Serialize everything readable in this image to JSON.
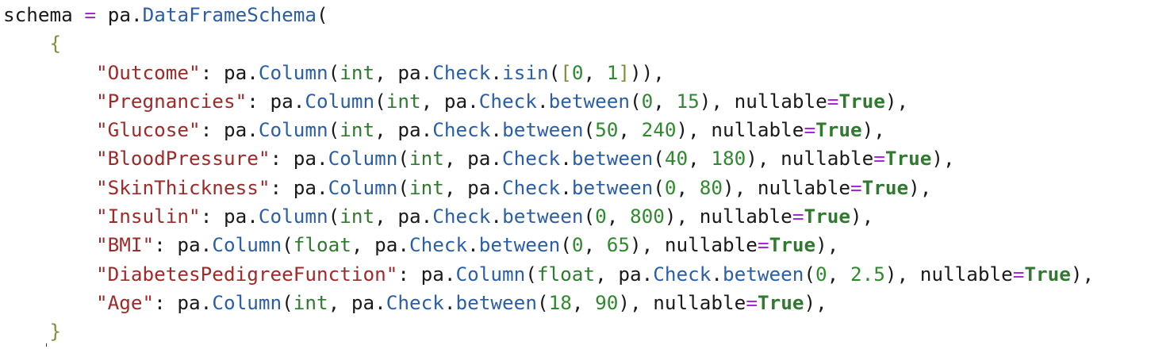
{
  "code": {
    "lines": [
      [
        {
          "t": "schema",
          "c": "plain"
        },
        {
          "t": " ",
          "c": "plain"
        },
        {
          "t": "=",
          "c": "op"
        },
        {
          "t": " pa.",
          "c": "plain"
        },
        {
          "t": "DataFrameSchema",
          "c": "attr"
        },
        {
          "t": "(",
          "c": "punct"
        }
      ],
      [
        {
          "t": "    ",
          "c": "plain"
        },
        {
          "t": "{",
          "c": "brace"
        }
      ],
      [
        {
          "t": "        ",
          "c": "plain"
        },
        {
          "t": "\"Outcome\"",
          "c": "str"
        },
        {
          "t": ": pa.",
          "c": "plain"
        },
        {
          "t": "Column",
          "c": "attr"
        },
        {
          "t": "(",
          "c": "punct"
        },
        {
          "t": "int",
          "c": "builtin"
        },
        {
          "t": ", pa.",
          "c": "plain"
        },
        {
          "t": "Check",
          "c": "attr"
        },
        {
          "t": ".",
          "c": "plain"
        },
        {
          "t": "isin",
          "c": "attr"
        },
        {
          "t": "(",
          "c": "punct"
        },
        {
          "t": "[",
          "c": "bracket"
        },
        {
          "t": "0",
          "c": "num"
        },
        {
          "t": ", ",
          "c": "plain"
        },
        {
          "t": "1",
          "c": "num"
        },
        {
          "t": "]",
          "c": "bracket"
        },
        {
          "t": ")),",
          "c": "punct"
        }
      ],
      [
        {
          "t": "        ",
          "c": "plain"
        },
        {
          "t": "\"Pregnancies\"",
          "c": "str"
        },
        {
          "t": ": pa.",
          "c": "plain"
        },
        {
          "t": "Column",
          "c": "attr"
        },
        {
          "t": "(",
          "c": "punct"
        },
        {
          "t": "int",
          "c": "builtin"
        },
        {
          "t": ", pa.",
          "c": "plain"
        },
        {
          "t": "Check",
          "c": "attr"
        },
        {
          "t": ".",
          "c": "plain"
        },
        {
          "t": "between",
          "c": "attr"
        },
        {
          "t": "(",
          "c": "punct"
        },
        {
          "t": "0",
          "c": "num"
        },
        {
          "t": ", ",
          "c": "plain"
        },
        {
          "t": "15",
          "c": "num"
        },
        {
          "t": "), nullable",
          "c": "plain"
        },
        {
          "t": "=",
          "c": "op"
        },
        {
          "t": "True",
          "c": "kw"
        },
        {
          "t": "),",
          "c": "punct"
        }
      ],
      [
        {
          "t": "        ",
          "c": "plain"
        },
        {
          "t": "\"Glucose\"",
          "c": "str"
        },
        {
          "t": ": pa.",
          "c": "plain"
        },
        {
          "t": "Column",
          "c": "attr"
        },
        {
          "t": "(",
          "c": "punct"
        },
        {
          "t": "int",
          "c": "builtin"
        },
        {
          "t": ", pa.",
          "c": "plain"
        },
        {
          "t": "Check",
          "c": "attr"
        },
        {
          "t": ".",
          "c": "plain"
        },
        {
          "t": "between",
          "c": "attr"
        },
        {
          "t": "(",
          "c": "punct"
        },
        {
          "t": "50",
          "c": "num"
        },
        {
          "t": ", ",
          "c": "plain"
        },
        {
          "t": "240",
          "c": "num"
        },
        {
          "t": "), nullable",
          "c": "plain"
        },
        {
          "t": "=",
          "c": "op"
        },
        {
          "t": "True",
          "c": "kw"
        },
        {
          "t": "),",
          "c": "punct"
        }
      ],
      [
        {
          "t": "        ",
          "c": "plain"
        },
        {
          "t": "\"BloodPressure\"",
          "c": "str"
        },
        {
          "t": ": pa.",
          "c": "plain"
        },
        {
          "t": "Column",
          "c": "attr"
        },
        {
          "t": "(",
          "c": "punct"
        },
        {
          "t": "int",
          "c": "builtin"
        },
        {
          "t": ", pa.",
          "c": "plain"
        },
        {
          "t": "Check",
          "c": "attr"
        },
        {
          "t": ".",
          "c": "plain"
        },
        {
          "t": "between",
          "c": "attr"
        },
        {
          "t": "(",
          "c": "punct"
        },
        {
          "t": "40",
          "c": "num"
        },
        {
          "t": ", ",
          "c": "plain"
        },
        {
          "t": "180",
          "c": "num"
        },
        {
          "t": "), nullable",
          "c": "plain"
        },
        {
          "t": "=",
          "c": "op"
        },
        {
          "t": "True",
          "c": "kw"
        },
        {
          "t": "),",
          "c": "punct"
        }
      ],
      [
        {
          "t": "        ",
          "c": "plain"
        },
        {
          "t": "\"SkinThickness\"",
          "c": "str"
        },
        {
          "t": ": pa.",
          "c": "plain"
        },
        {
          "t": "Column",
          "c": "attr"
        },
        {
          "t": "(",
          "c": "punct"
        },
        {
          "t": "int",
          "c": "builtin"
        },
        {
          "t": ", pa.",
          "c": "plain"
        },
        {
          "t": "Check",
          "c": "attr"
        },
        {
          "t": ".",
          "c": "plain"
        },
        {
          "t": "between",
          "c": "attr"
        },
        {
          "t": "(",
          "c": "punct"
        },
        {
          "t": "0",
          "c": "num"
        },
        {
          "t": ", ",
          "c": "plain"
        },
        {
          "t": "80",
          "c": "num"
        },
        {
          "t": "), nullable",
          "c": "plain"
        },
        {
          "t": "=",
          "c": "op"
        },
        {
          "t": "True",
          "c": "kw"
        },
        {
          "t": "),",
          "c": "punct"
        }
      ],
      [
        {
          "t": "        ",
          "c": "plain"
        },
        {
          "t": "\"Insulin\"",
          "c": "str"
        },
        {
          "t": ": pa.",
          "c": "plain"
        },
        {
          "t": "Column",
          "c": "attr"
        },
        {
          "t": "(",
          "c": "punct"
        },
        {
          "t": "int",
          "c": "builtin"
        },
        {
          "t": ", pa.",
          "c": "plain"
        },
        {
          "t": "Check",
          "c": "attr"
        },
        {
          "t": ".",
          "c": "plain"
        },
        {
          "t": "between",
          "c": "attr"
        },
        {
          "t": "(",
          "c": "punct"
        },
        {
          "t": "0",
          "c": "num"
        },
        {
          "t": ", ",
          "c": "plain"
        },
        {
          "t": "800",
          "c": "num"
        },
        {
          "t": "), nullable",
          "c": "plain"
        },
        {
          "t": "=",
          "c": "op"
        },
        {
          "t": "True",
          "c": "kw"
        },
        {
          "t": "),",
          "c": "punct"
        }
      ],
      [
        {
          "t": "        ",
          "c": "plain"
        },
        {
          "t": "\"BMI\"",
          "c": "str"
        },
        {
          "t": ": pa.",
          "c": "plain"
        },
        {
          "t": "Column",
          "c": "attr"
        },
        {
          "t": "(",
          "c": "punct"
        },
        {
          "t": "float",
          "c": "builtin"
        },
        {
          "t": ", pa.",
          "c": "plain"
        },
        {
          "t": "Check",
          "c": "attr"
        },
        {
          "t": ".",
          "c": "plain"
        },
        {
          "t": "between",
          "c": "attr"
        },
        {
          "t": "(",
          "c": "punct"
        },
        {
          "t": "0",
          "c": "num"
        },
        {
          "t": ", ",
          "c": "plain"
        },
        {
          "t": "65",
          "c": "num"
        },
        {
          "t": "), nullable",
          "c": "plain"
        },
        {
          "t": "=",
          "c": "op"
        },
        {
          "t": "True",
          "c": "kw"
        },
        {
          "t": "),",
          "c": "punct"
        }
      ],
      [
        {
          "t": "        ",
          "c": "plain"
        },
        {
          "t": "\"DiabetesPedigreeFunction\"",
          "c": "str"
        },
        {
          "t": ": pa.",
          "c": "plain"
        },
        {
          "t": "Column",
          "c": "attr"
        },
        {
          "t": "(",
          "c": "punct"
        },
        {
          "t": "float",
          "c": "builtin"
        },
        {
          "t": ", pa.",
          "c": "plain"
        },
        {
          "t": "Check",
          "c": "attr"
        },
        {
          "t": ".",
          "c": "plain"
        },
        {
          "t": "between",
          "c": "attr"
        },
        {
          "t": "(",
          "c": "punct"
        },
        {
          "t": "0",
          "c": "num"
        },
        {
          "t": ", ",
          "c": "plain"
        },
        {
          "t": "2.5",
          "c": "num"
        },
        {
          "t": "), nullable",
          "c": "plain"
        },
        {
          "t": "=",
          "c": "op"
        },
        {
          "t": "True",
          "c": "kw"
        },
        {
          "t": "),",
          "c": "punct"
        }
      ],
      [
        {
          "t": "        ",
          "c": "plain"
        },
        {
          "t": "\"Age\"",
          "c": "str"
        },
        {
          "t": ": pa.",
          "c": "plain"
        },
        {
          "t": "Column",
          "c": "attr"
        },
        {
          "t": "(",
          "c": "punct"
        },
        {
          "t": "int",
          "c": "builtin"
        },
        {
          "t": ", pa.",
          "c": "plain"
        },
        {
          "t": "Check",
          "c": "attr"
        },
        {
          "t": ".",
          "c": "plain"
        },
        {
          "t": "between",
          "c": "attr"
        },
        {
          "t": "(",
          "c": "punct"
        },
        {
          "t": "18",
          "c": "num"
        },
        {
          "t": ", ",
          "c": "plain"
        },
        {
          "t": "90",
          "c": "num"
        },
        {
          "t": "), nullable",
          "c": "plain"
        },
        {
          "t": "=",
          "c": "op"
        },
        {
          "t": "True",
          "c": "kw"
        },
        {
          "t": "),",
          "c": "punct"
        }
      ],
      [
        {
          "t": "    ",
          "c": "plain"
        },
        {
          "t": "}",
          "c": "brace"
        }
      ]
    ]
  },
  "colors": {
    "plain": "#1a1a1a",
    "operator": "#a626d8",
    "attribute": "#2a5ea8",
    "string": "#a02a2a",
    "number": "#2f8a2f",
    "keyword": "#2f7a2f",
    "brace": "#7f8f3a"
  }
}
